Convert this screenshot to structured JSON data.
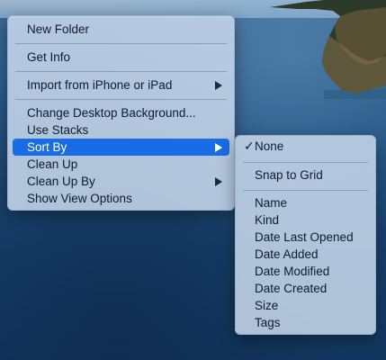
{
  "main_menu": {
    "items": [
      {
        "label": "New Folder"
      },
      {
        "label": "Get Info"
      },
      {
        "label": "Import from iPhone or iPad"
      },
      {
        "label": "Change Desktop Background..."
      },
      {
        "label": "Use Stacks"
      },
      {
        "label": "Sort By",
        "selected": true
      },
      {
        "label": "Clean Up"
      },
      {
        "label": "Clean Up By"
      },
      {
        "label": "Show View Options"
      }
    ]
  },
  "sort_by_submenu": {
    "items": [
      {
        "label": "None",
        "checked": true,
        "check_glyph": "✓"
      },
      {
        "label": "Snap to Grid"
      },
      {
        "label": "Name"
      },
      {
        "label": "Kind"
      },
      {
        "label": "Date Last Opened"
      },
      {
        "label": "Date Added"
      },
      {
        "label": "Date Modified"
      },
      {
        "label": "Date Created"
      },
      {
        "label": "Size"
      },
      {
        "label": "Tags"
      }
    ]
  },
  "colors": {
    "selection": "#1a6ce4",
    "menu_background": "#c5d6e9"
  },
  "icons": {
    "submenu_arrow": "chevron-right-icon",
    "checkmark": "checkmark-icon"
  }
}
